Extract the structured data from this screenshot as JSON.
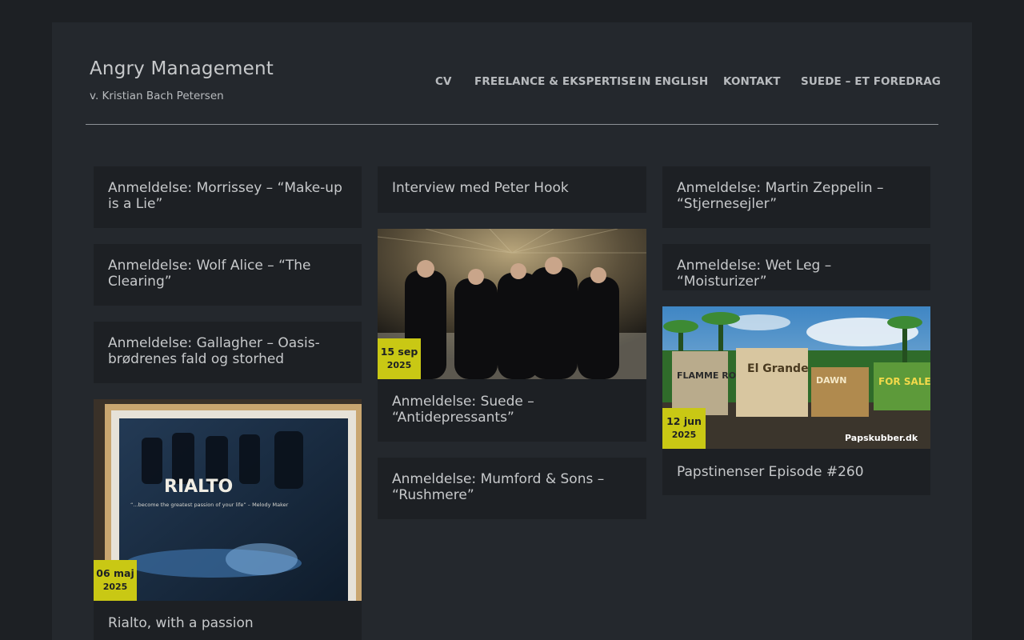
{
  "site": {
    "title": "Angry Management",
    "description": "v. Kristian Bach Petersen"
  },
  "nav": [
    {
      "label": "CV"
    },
    {
      "label": "FREELANCE & EKSPERTISE"
    },
    {
      "label": "IN ENGLISH"
    },
    {
      "label": "KONTAKT"
    },
    {
      "label": "SUEDE – ET FOREDRAG"
    }
  ],
  "posts": {
    "morrissey": {
      "title": "Anmeldelse: Morrissey – “Make-up is a Lie”"
    },
    "wolf_alice": {
      "title": "Anmeldelse: Wolf Alice – “The Clearing”"
    },
    "gallagher": {
      "title": "Anmeldelse: Gallagher – Oasis-brødrenes fald og storhed"
    },
    "rialto": {
      "title": "Rialto, with a passion",
      "date_day_month": "06 maj",
      "date_year": "2025",
      "image_text": "RIALTO",
      "image_caption": "“...become the greatest passion of your life” – Melody Maker"
    },
    "peter_hook": {
      "title": "Interview med Peter Hook"
    },
    "suede": {
      "title": "Anmeldelse: Suede – “Antidepressants”",
      "date_day_month": "15 sep",
      "date_year": "2025"
    },
    "mumford": {
      "title": "Anmeldelse: Mumford & Sons – “Rushmere”"
    },
    "martin_zeppelin": {
      "title": "Anmeldelse: Martin Zeppelin – “Stjernesejler”"
    },
    "wet_leg": {
      "title": "Anmeldelse: Wet Leg – “Moisturizer”"
    },
    "papstinenser": {
      "title": "Papstinenser Episode #260",
      "date_day_month": "12 jun",
      "date_year": "2025",
      "image_boxes": [
        "FLAMME ROUGE",
        "El Grande",
        "DAWN",
        "FOR SALE"
      ],
      "image_brand": "Papskubber.dk"
    }
  },
  "colors": {
    "outer_background": "#1d2024",
    "page_background": "#24282d",
    "card_background": "#1d2024",
    "date_badge": "#c9c814",
    "text": "#c7c9cb"
  }
}
